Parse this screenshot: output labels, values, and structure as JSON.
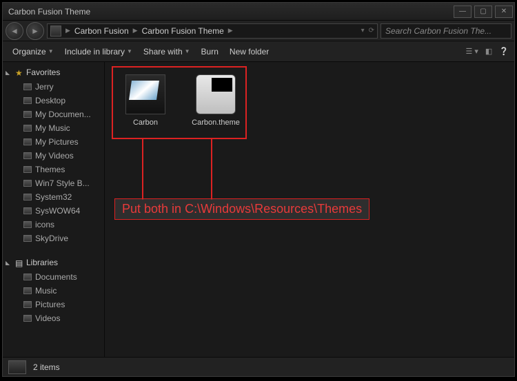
{
  "title": "Carbon Fusion Theme",
  "breadcrumbs": [
    "Carbon Fusion",
    "Carbon Fusion Theme"
  ],
  "search_placeholder": "Search Carbon Fusion The...",
  "toolbar": {
    "organize": "Organize",
    "include": "Include in library",
    "share": "Share with",
    "burn": "Burn",
    "newfolder": "New folder"
  },
  "sidebar": {
    "favorites_label": "Favorites",
    "favorites": [
      "Jerry",
      "Desktop",
      "My Documen...",
      "My Music",
      "My Pictures",
      "My Videos",
      "Themes",
      "Win7 Style B...",
      "System32",
      "SysWOW64",
      "icons",
      "SkyDrive"
    ],
    "libraries_label": "Libraries",
    "libraries": [
      "Documents",
      "Music",
      "Pictures",
      "Videos"
    ]
  },
  "files": [
    {
      "name": "Carbon",
      "kind": "folder-preview"
    },
    {
      "name": "Carbon.theme",
      "kind": "theme"
    }
  ],
  "annotation": "Put both in C:\\Windows\\Resources\\Themes",
  "status": {
    "count_text": "2 items"
  }
}
